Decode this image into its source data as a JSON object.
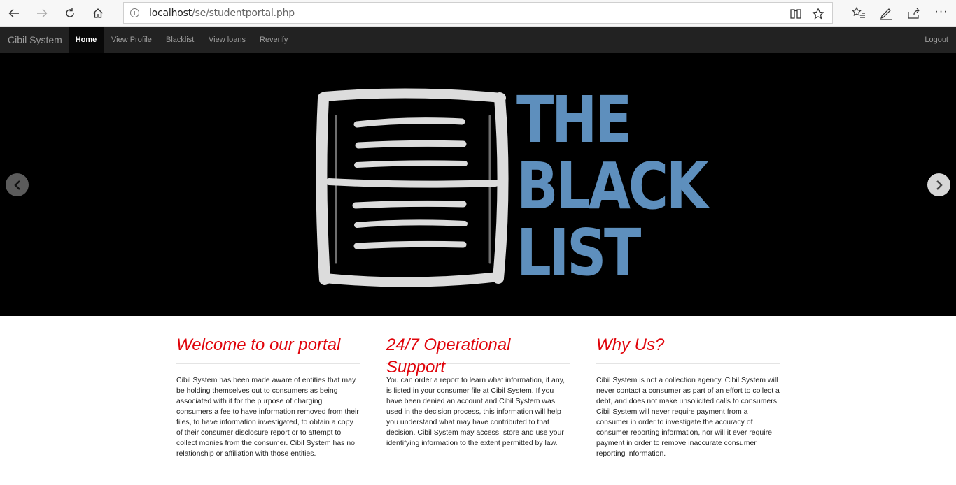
{
  "browser": {
    "url_host": "localhost",
    "url_path": "/se/studentportal.php"
  },
  "navbar": {
    "brand": "Cibil System",
    "items": [
      {
        "label": "Home",
        "active": true
      },
      {
        "label": "View Profile"
      },
      {
        "label": "Blacklist"
      },
      {
        "label": "View loans"
      },
      {
        "label": "Reverify"
      }
    ],
    "logout": "Logout"
  },
  "carousel": {
    "slide_text": [
      "THE",
      "BLACK",
      "LIST"
    ],
    "accent_color": "#5e8fbd"
  },
  "columns": [
    {
      "title": "Welcome to our portal",
      "body": "Cibil System has been made aware of entities that may be holding themselves out to consumers as being associated with it for the purpose of charging consumers a fee to have information removed from their files, to have information investigated, to obtain a copy of their consumer disclosure report or to attempt to collect monies from the consumer. Cibil System has no relationship or affiliation with those entities."
    },
    {
      "title": "24/7 Operational Support",
      "body": "You can order a report to learn what information, if any, is listed in your consumer file at Cibil System. If you have been denied an account and Cibil System was used in the decision process, this information will help you understand what may have contributed to that decision. Cibil System may access, store and use your identifying information to the extent permitted by law."
    },
    {
      "title": "Why Us?",
      "body": "Cibil System is not a collection agency. Cibil System will never contact a consumer as part of an effort to collect a debt, and does not make unsolicited calls to consumers. Cibil System will never require payment from a consumer in order to investigate the accuracy of consumer reporting information, nor will it ever require payment in order to remove inaccurate consumer reporting information."
    }
  ],
  "colors": {
    "heading": "#e0040b",
    "navbar": "#222222"
  }
}
